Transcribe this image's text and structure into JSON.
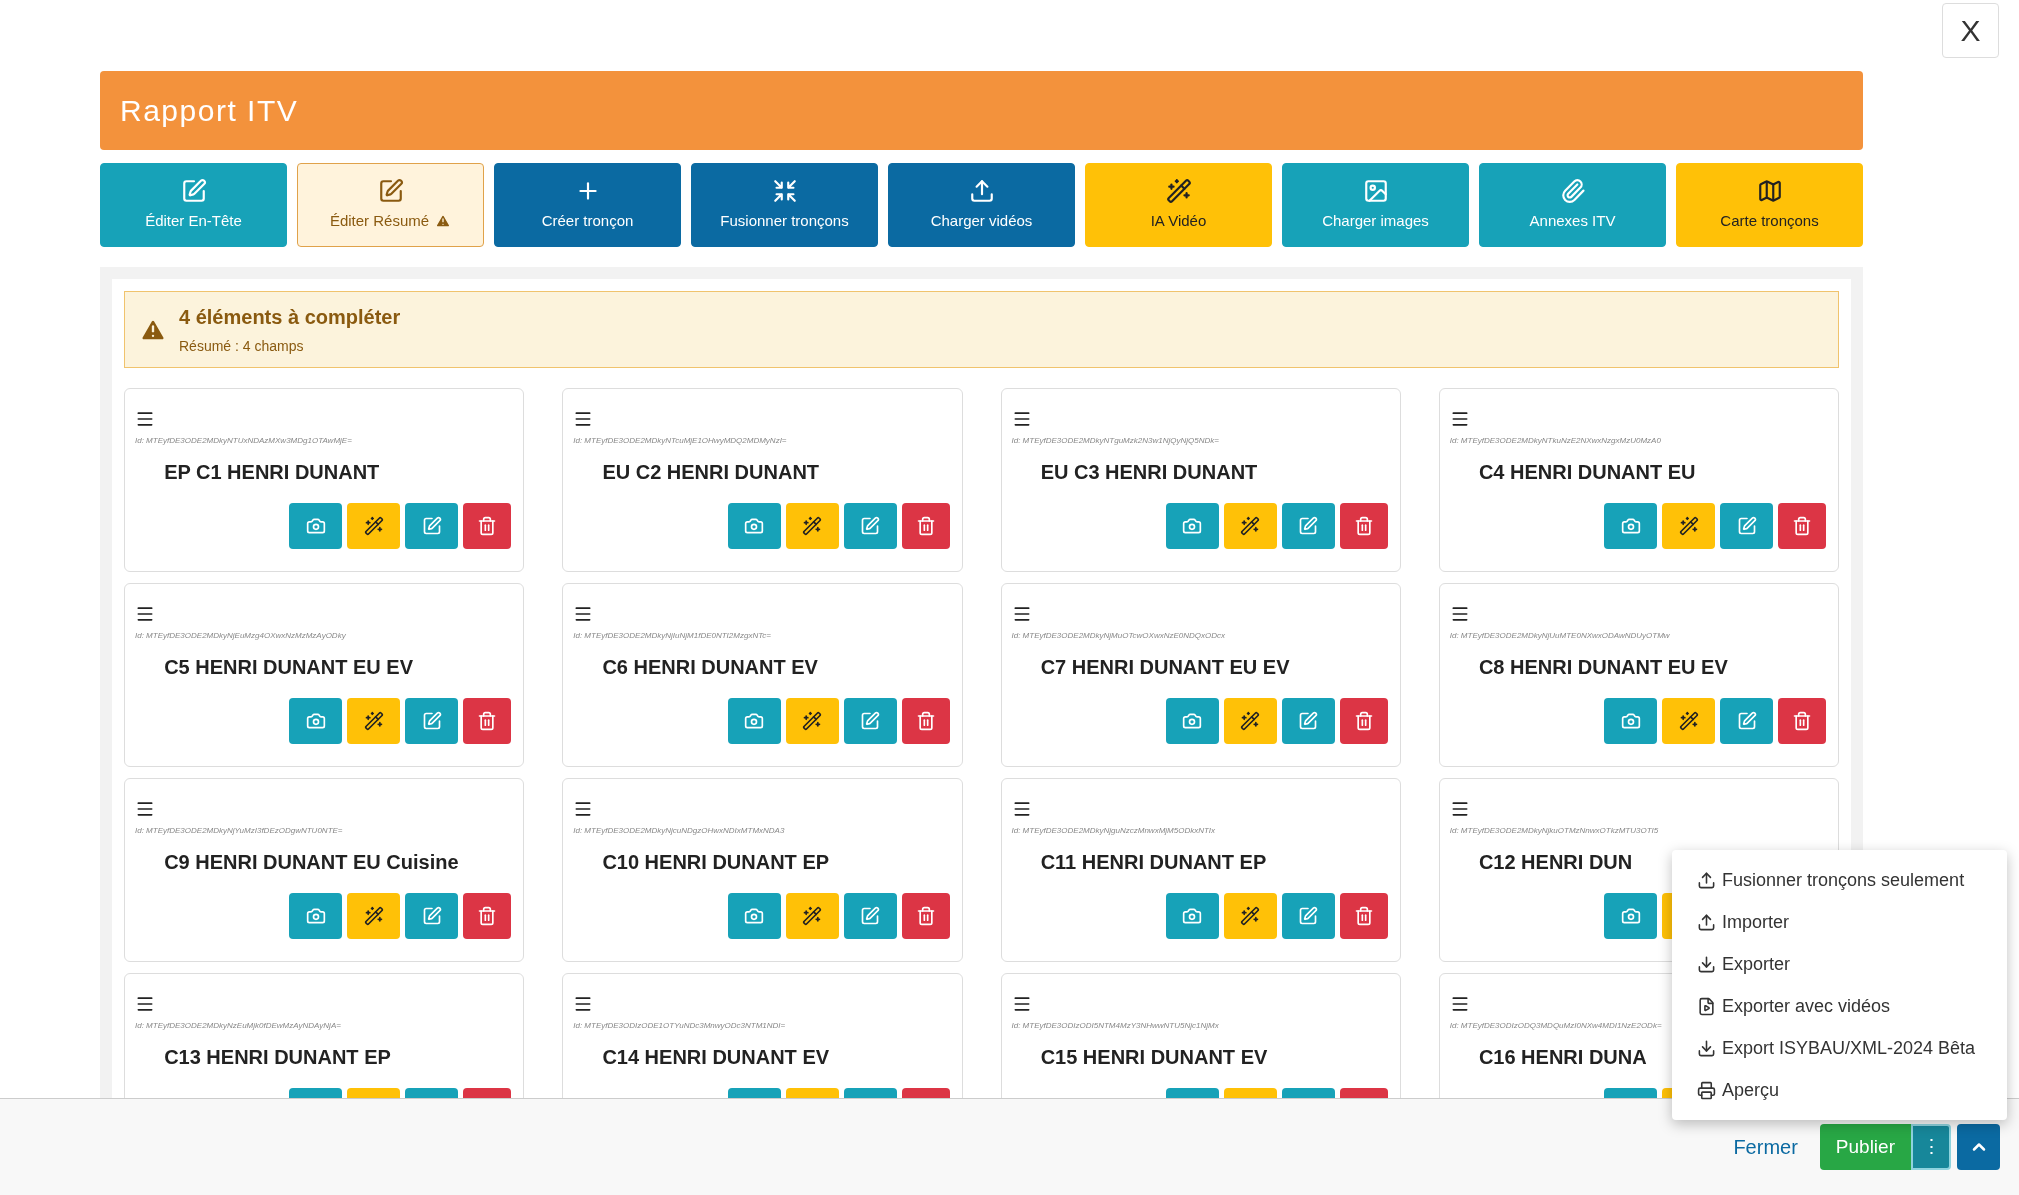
{
  "close_button": "X",
  "title": "Rapport ITV",
  "toolbar": [
    {
      "label": "Éditer En-Tête",
      "kind": "teal",
      "warning": false
    },
    {
      "label": "Éditer Résumé",
      "kind": "light",
      "warning": true
    },
    {
      "label": "Créer tronçon",
      "kind": "blue",
      "warning": false
    },
    {
      "label": "Fusionner tronçons",
      "kind": "blue",
      "warning": false
    },
    {
      "label": "Charger vidéos",
      "kind": "blue",
      "warning": false
    },
    {
      "label": "IA Vidéo",
      "kind": "yellow",
      "warning": false
    },
    {
      "label": "Charger images",
      "kind": "teal",
      "warning": false
    },
    {
      "label": "Annexes ITV",
      "kind": "teal",
      "warning": false
    },
    {
      "label": "Carte tronçons",
      "kind": "yellow",
      "warning": false
    }
  ],
  "alert": {
    "title": "4 éléments à compléter",
    "detail": "Résumé : 4 champs"
  },
  "sections": [
    {
      "id": "Id: MTEyfDE3ODE2MDkyNTUxNDAzMXw3MDg1OTAwMjE=",
      "name": "EP C1 HENRI DUNANT"
    },
    {
      "id": "Id: MTEyfDE3ODE2MDkyNTcuMjE1OHwyMDQ2MDMyNzI=",
      "name": "EU C2 HENRI DUNANT"
    },
    {
      "id": "Id: MTEyfDE3ODE2MDkyNTguMzk2N3w1NjQyNjQ5NDk=",
      "name": "EU C3 HENRI DUNANT"
    },
    {
      "id": "Id: MTEyfDE3ODE2MDkyNTkuNzE2NXwxNzgxMzU0MzA0",
      "name": "C4 HENRI DUNANT EU"
    },
    {
      "id": "Id: MTEyfDE3ODE2MDkyNjEuMzg4OXwxNzMzMzAyODky",
      "name": "C5 HENRI DUNANT EU EV"
    },
    {
      "id": "Id: MTEyfDE3ODE2MDkyNjIuNjM1fDE0NTI2MzgxNTc=",
      "name": "C6 HENRI DUNANT EV"
    },
    {
      "id": "Id: MTEyfDE3ODE2MDkyNjMuOTcwOXwxNzE0NDQxODcx",
      "name": "C7 HENRI DUNANT EU EV"
    },
    {
      "id": "Id: MTEyfDE3ODE2MDkyNjUuMTE0NXwxODAwNDUyOTMw",
      "name": "C8 HENRI DUNANT EU EV"
    },
    {
      "id": "Id: MTEyfDE3ODE2MDkyNjYuMzI3fDEzODgwNTU0NTE=",
      "name": "C9 HENRI DUNANT EU Cuisine"
    },
    {
      "id": "Id: MTEyfDE3ODE2MDkyNjcuNDgzOHwxNDIxMTMxNDA3",
      "name": "C10 HENRI DUNANT EP"
    },
    {
      "id": "Id: MTEyfDE3ODE2MDkyNjguNzczMnwxMjM5ODkxNTIx",
      "name": "C11 HENRI DUNANT EP"
    },
    {
      "id": "Id: MTEyfDE3ODE2MDkyNjkuOTMzNnwxOTkzMTU3OTI5",
      "name": "C12 HENRI DUN"
    },
    {
      "id": "Id: MTEyfDE3ODE2MDkyNzEuMjk0fDEwMzAyNDAyNjA=",
      "name": "C13 HENRI DUNANT EP"
    },
    {
      "id": "Id: MTEyfDE3ODIzODE1OTYuNDc3MnwyODc3NTM1NDI=",
      "name": "C14 HENRI DUNANT EV"
    },
    {
      "id": "Id: MTEyfDE3ODIzODI5NTM4MzY3NHwwNTU5Njc1NjMx",
      "name": "C15 HENRI DUNANT EV"
    },
    {
      "id": "Id: MTEyfDE3ODIzODQ3MDQuMzI0NXw4MDI1NzE2ODk=",
      "name": "C16 HENRI DUNA"
    }
  ],
  "menu": [
    {
      "label": "Fusionner tronçons seulement",
      "kind": "upload"
    },
    {
      "label": "Importer",
      "kind": "upload"
    },
    {
      "label": "Exporter",
      "kind": "download"
    },
    {
      "label": "Exporter avec vidéos",
      "kind": "video"
    },
    {
      "label": "Export ISYBAU/XML-2024 Bêta",
      "kind": "download"
    },
    {
      "label": "Aperçu",
      "kind": "print"
    }
  ],
  "footer": {
    "close": "Fermer",
    "publish": "Publier",
    "more": "⋮"
  }
}
